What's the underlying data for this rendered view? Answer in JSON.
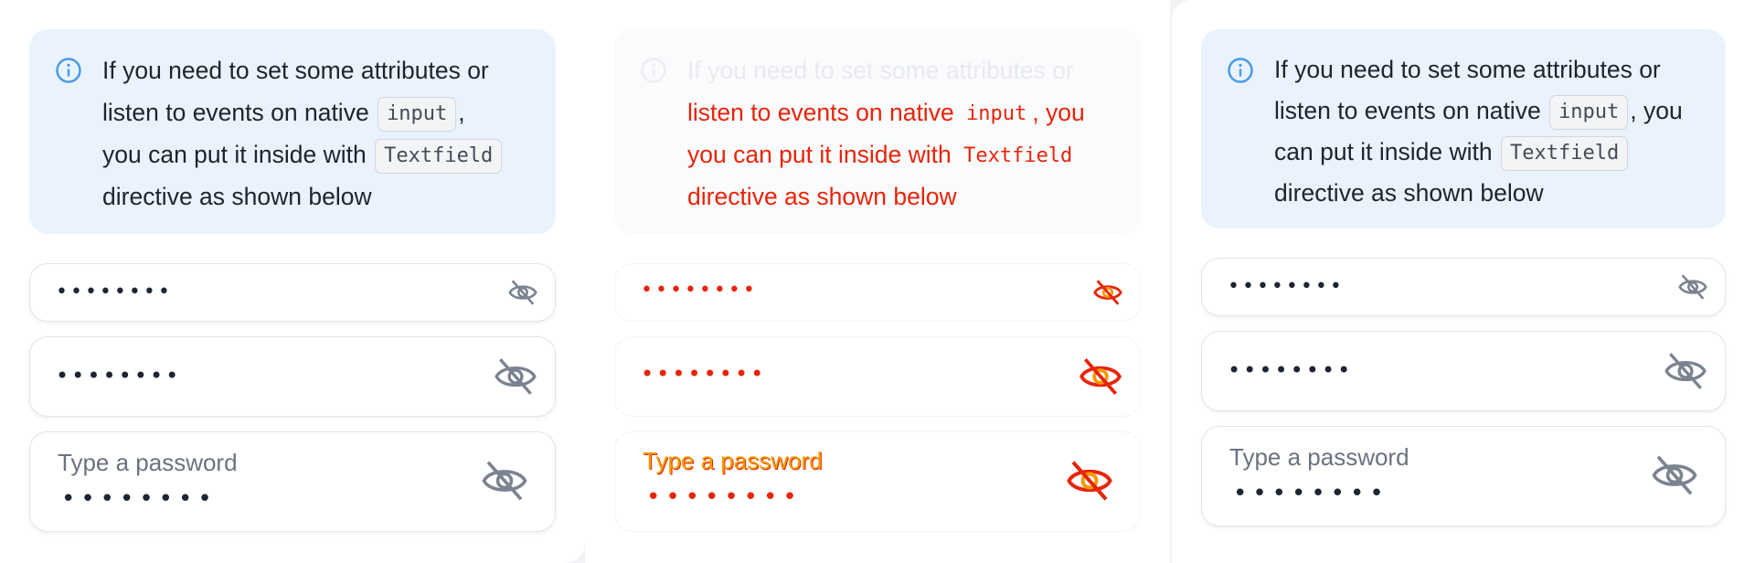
{
  "alert": {
    "line1": "If you need to set some attributes or",
    "pre_input": "listen to events on native",
    "code_input": "input",
    "post_input": ",",
    "pre_textfield": "you can put it inside with",
    "code_textfield": "Textfield",
    "line4": "directive as shown below",
    "right_post_input": ", you",
    "right_pre_textfield": "can put it inside with"
  },
  "fields": {
    "masked_value": "••••••••",
    "label": "Type a password",
    "eye_icon": "eye-off-icon"
  },
  "colors": {
    "alert_bg": "#eaf3fd",
    "info_icon": "#4a9be8",
    "glitch_red": "#e8240a",
    "eye_icon": "#7b8290"
  }
}
